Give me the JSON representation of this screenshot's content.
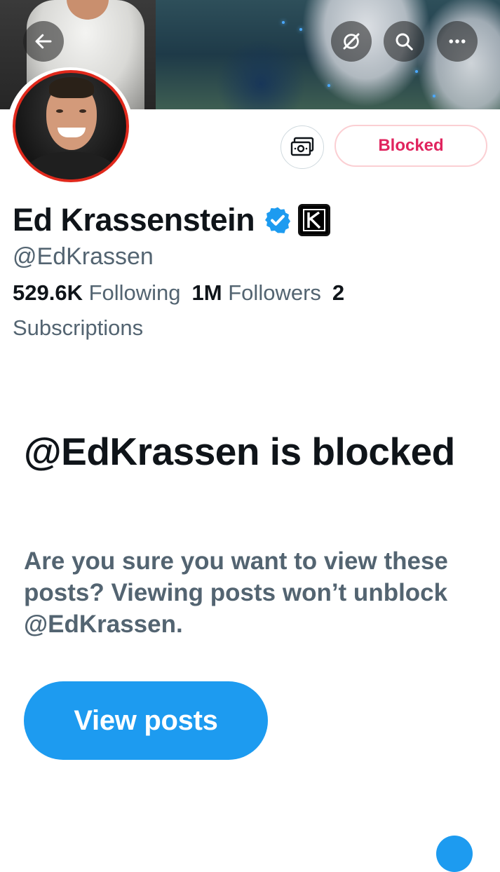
{
  "header": {
    "back_icon": "arrow-left-icon",
    "grok_icon": "grok-slash-circle-icon",
    "search_icon": "search-icon",
    "more_icon": "more-horizontal-icon"
  },
  "profile": {
    "display_name": "Ed Krassenstein",
    "handle": "@EdKrassen",
    "verified_icon": "verified-badge-icon",
    "affiliate_badge_letter": "K",
    "subscribe_icon": "money-subscription-icon",
    "blocked_button_label": "Blocked",
    "stats": {
      "following_count": "529.6K",
      "following_label": "Following",
      "followers_count": "1M",
      "followers_label": "Followers",
      "subscriptions_count": "2",
      "subscriptions_label": "Subscriptions"
    }
  },
  "blocked_notice": {
    "title": "@EdKrassen is blocked",
    "description": "Are you sure you want to view these posts? Viewing posts won’t unblock @EdKrassen.",
    "view_posts_label": "View posts"
  },
  "colors": {
    "accent_blue": "#1d9bf0",
    "blocked_red": "#e0245e",
    "secondary_text": "#536471",
    "primary_text": "#0f1419",
    "avatar_ring_red": "#e0291c"
  }
}
